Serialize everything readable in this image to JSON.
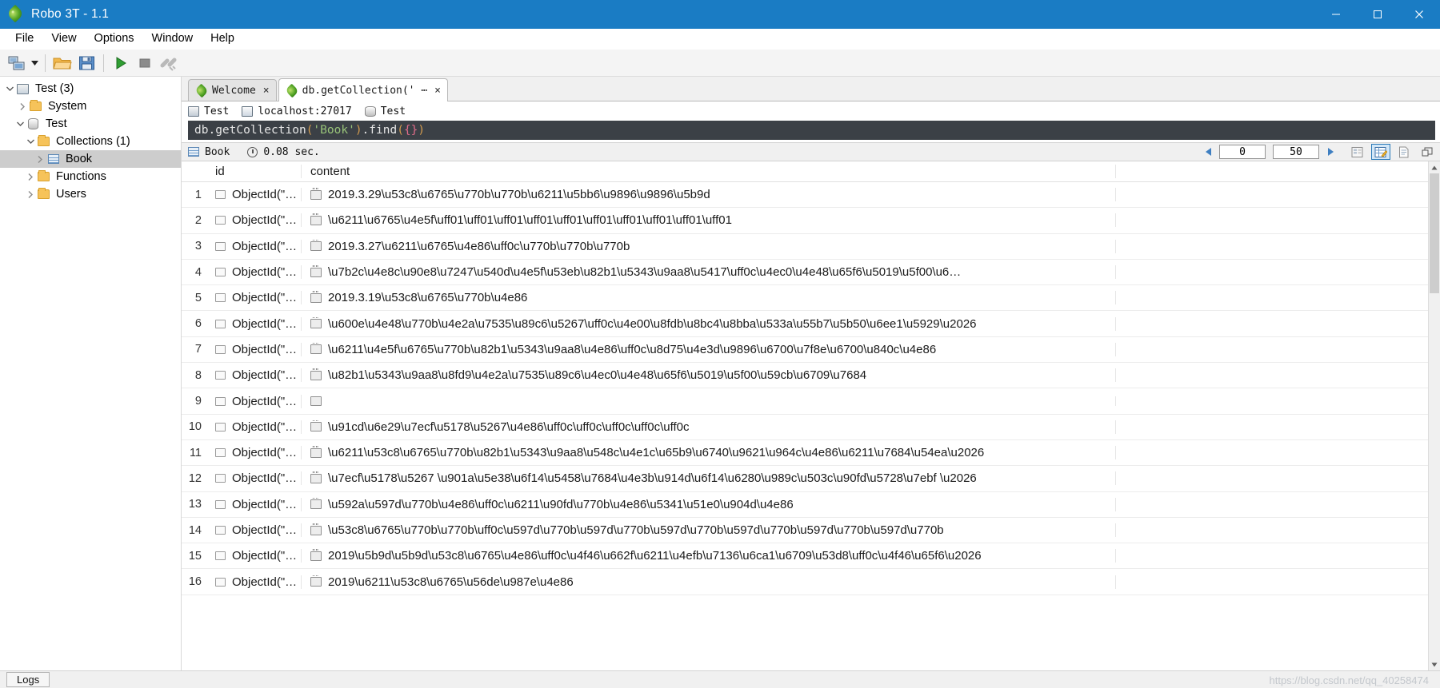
{
  "window": {
    "title": "Robo 3T - 1.1",
    "app_icon": "leaf-icon",
    "accent_color": "#1a7cc4",
    "minimize": "minimize-icon",
    "maximize": "maximize-icon",
    "close": "close-icon"
  },
  "menubar": {
    "items": [
      {
        "label": "File"
      },
      {
        "label": "View"
      },
      {
        "label": "Options"
      },
      {
        "label": "Window"
      },
      {
        "label": "Help"
      }
    ]
  },
  "toolbar": {
    "buttons": [
      {
        "name": "connect-icon"
      },
      {
        "name": "chevron-down-icon"
      },
      {
        "name": "open-folder-icon"
      },
      {
        "name": "save-icon"
      },
      {
        "name": "execute-play-icon"
      },
      {
        "name": "stop-icon"
      },
      {
        "name": "broken-link-icon"
      }
    ]
  },
  "sidebar": {
    "items": [
      {
        "label": "Test (3)",
        "icon": "server-icon",
        "depth": 0,
        "twisty": "expanded",
        "selected": false
      },
      {
        "label": "System",
        "icon": "folder-icon",
        "depth": 1,
        "twisty": "collapsed",
        "selected": false
      },
      {
        "label": "Test",
        "icon": "database-icon",
        "depth": 1,
        "twisty": "expanded",
        "selected": false
      },
      {
        "label": "Collections (1)",
        "icon": "folder-icon",
        "depth": 2,
        "twisty": "expanded",
        "selected": false
      },
      {
        "label": "Book",
        "icon": "collection-grid-icon",
        "depth": 3,
        "twisty": "collapsed",
        "selected": true
      },
      {
        "label": "Functions",
        "icon": "folder-icon",
        "depth": 2,
        "twisty": "collapsed",
        "selected": false
      },
      {
        "label": "Users",
        "icon": "folder-icon",
        "depth": 2,
        "twisty": "collapsed",
        "selected": false
      }
    ]
  },
  "tabs": [
    {
      "label": "Welcome",
      "icon": "leaf-icon",
      "close": "×",
      "active": false
    },
    {
      "label": "db.getCollection(' ⋯",
      "icon": "leaf-icon",
      "close": "×",
      "active": true
    }
  ],
  "connection_info": {
    "server": "Test",
    "host": "localhost:27017",
    "database": "Test",
    "server_icon": "server-icon",
    "host_icon": "monitor-icon",
    "db_icon": "database-icon"
  },
  "query": {
    "prefix": "db.getCollection",
    "open_paren": "(",
    "string": "'Book'",
    "close_paren": ")",
    "method": ".find",
    "method_open": "(",
    "braces": "{}",
    "method_close": ")",
    "full_text": "db.getCollection('Book').find({})"
  },
  "result_toolbar": {
    "collection": "Book",
    "collection_icon": "collection-grid-icon",
    "time_icon": "clock-icon",
    "elapsed": "0.08 sec.",
    "prev_icon": "prev-arrow-icon",
    "next_icon": "next-arrow-icon",
    "skip_value": "0",
    "limit_value": "50",
    "view_tree_icon": "tree-view-icon",
    "view_table_icon": "table-view-icon",
    "view_text_icon": "text-view-icon",
    "maximize_icon": "maximize-pane-icon"
  },
  "grid": {
    "columns": [
      "id",
      "content"
    ],
    "rows": [
      {
        "n": "1",
        "id": "ObjectId(\"…",
        "content": "2019.3.29\\u53c8\\u6765\\u770b\\u770b\\u6211\\u5bb6\\u9896\\u9896\\u5b9d"
      },
      {
        "n": "2",
        "id": "ObjectId(\"…",
        "content": "\\u6211\\u6765\\u4e5f\\uff01\\uff01\\uff01\\uff01\\uff01\\uff01\\uff01\\uff01\\uff01\\uff01"
      },
      {
        "n": "3",
        "id": "ObjectId(\"…",
        "content": "2019.3.27\\u6211\\u6765\\u4e86\\uff0c\\u770b\\u770b\\u770b"
      },
      {
        "n": "4",
        "id": "ObjectId(\"…",
        "content": "\\u7b2c\\u4e8c\\u90e8\\u7247\\u540d\\u4e5f\\u53eb\\u82b1\\u5343\\u9aa8\\u5417\\uff0c\\u4ec0\\u4e48\\u65f6\\u5019\\u5f00\\u6…"
      },
      {
        "n": "5",
        "id": "ObjectId(\"…",
        "content": "2019.3.19\\u53c8\\u6765\\u770b\\u4e86"
      },
      {
        "n": "6",
        "id": "ObjectId(\"…",
        "content": "\\u600e\\u4e48\\u770b\\u4e2a\\u7535\\u89c6\\u5267\\uff0c\\u4e00\\u8fdb\\u8bc4\\u8bba\\u533a\\u55b7\\u5b50\\u6ee1\\u5929\\u2026"
      },
      {
        "n": "7",
        "id": "ObjectId(\"…",
        "content": "\\u6211\\u4e5f\\u6765\\u770b\\u82b1\\u5343\\u9aa8\\u4e86\\uff0c\\u8d75\\u4e3d\\u9896\\u6700\\u7f8e\\u6700\\u840c\\u4e86"
      },
      {
        "n": "8",
        "id": "ObjectId(\"…",
        "content": "\\u82b1\\u5343\\u9aa8\\u8fd9\\u4e2a\\u7535\\u89c6\\u4ec0\\u4e48\\u65f6\\u5019\\u5f00\\u59cb\\u6709\\u7684"
      },
      {
        "n": "9",
        "id": "ObjectId(\"…",
        "content": ""
      },
      {
        "n": "10",
        "id": "ObjectId(\"…",
        "content": "\\u91cd\\u6e29\\u7ecf\\u5178\\u5267\\u4e86\\uff0c\\uff0c\\uff0c\\uff0c\\uff0c"
      },
      {
        "n": "11",
        "id": "ObjectId(\"…",
        "content": "\\u6211\\u53c8\\u6765\\u770b\\u82b1\\u5343\\u9aa8\\u548c\\u4e1c\\u65b9\\u6740\\u9621\\u964c\\u4e86\\u6211\\u7684\\u54ea\\u2026"
      },
      {
        "n": "12",
        "id": "ObjectId(\"…",
        "content": "\\u7ecf\\u5178\\u5267 \\u901a\\u5e38\\u6f14\\u5458\\u7684\\u4e3b\\u914d\\u6f14\\u6280\\u989c\\u503c\\u90fd\\u5728\\u7ebf \\u2026"
      },
      {
        "n": "13",
        "id": "ObjectId(\"…",
        "content": "\\u592a\\u597d\\u770b\\u4e86\\uff0c\\u6211\\u90fd\\u770b\\u4e86\\u5341\\u51e0\\u904d\\u4e86"
      },
      {
        "n": "14",
        "id": "ObjectId(\"…",
        "content": "\\u53c8\\u6765\\u770b\\u770b\\uff0c\\u597d\\u770b\\u597d\\u770b\\u597d\\u770b\\u597d\\u770b\\u597d\\u770b\\u597d\\u770b"
      },
      {
        "n": "15",
        "id": "ObjectId(\"…",
        "content": "2019\\u5b9d\\u5b9d\\u53c8\\u6765\\u4e86\\uff0c\\u4f46\\u662f\\u6211\\u4efb\\u7136\\u6ca1\\u6709\\u53d8\\uff0c\\u4f46\\u65f6\\u2026"
      },
      {
        "n": "16",
        "id": "ObjectId(\"…",
        "content": "2019\\u6211\\u53c8\\u6765\\u56de\\u987e\\u4e86"
      }
    ]
  },
  "statusbar": {
    "logs_label": "Logs",
    "watermark": "https://blog.csdn.net/qq_40258474"
  }
}
